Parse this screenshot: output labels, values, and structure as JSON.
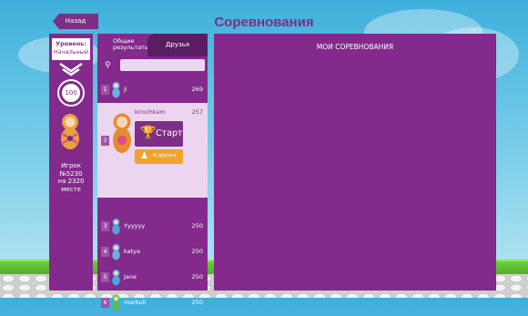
{
  "header": {
    "back_label": "Назад",
    "title": "Соревнования"
  },
  "sidebar": {
    "level_label": "Уровень:",
    "level_value": "Начальный",
    "score_badge": "100",
    "player_line1": "Игрок",
    "player_line2": "№5230",
    "player_line3": "на 2320",
    "player_line4": "месте"
  },
  "leaderboard": {
    "tab_general": "Общие результаты",
    "tab_friends": "Друзья",
    "search_placeholder": "",
    "rows": [
      {
        "rank": "1",
        "name": "ji",
        "score": "269"
      },
      {
        "rank": "3",
        "name": "Yyyyyy",
        "score": "250"
      },
      {
        "rank": "4",
        "name": "katya",
        "score": "250"
      },
      {
        "rank": "5",
        "name": "Jane",
        "score": "250"
      },
      {
        "rank": "6",
        "name": "markull",
        "score": "250"
      }
    ],
    "highlight": {
      "rank": "2",
      "name": "kirochkam",
      "score": "257",
      "start_label": "Старт",
      "friends_label": "В друзья"
    }
  },
  "main_panel": {
    "title": "МОИ СОРЕВНОВАНИЯ"
  },
  "colors": {
    "panel": "#832a8c",
    "highlight_bg": "#ecd5ef",
    "accent_orange": "#f3a32c",
    "sky": "#3eb0dc"
  }
}
